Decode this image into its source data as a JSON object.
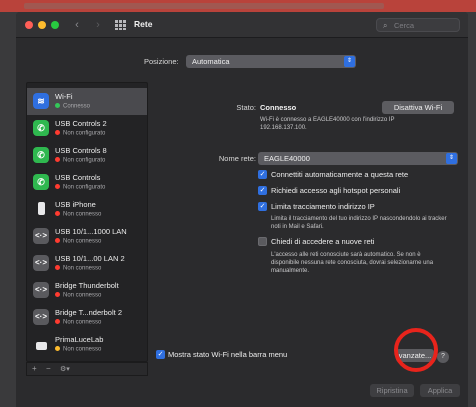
{
  "window": {
    "title": "Rete"
  },
  "search": {
    "placeholder": "Cerca"
  },
  "location": {
    "label": "Posizione:",
    "value": "Automatica"
  },
  "services": [
    {
      "name": "Wi-Fi",
      "status": "Connesso",
      "status_color": "#34c759",
      "icon": "wifi-icon",
      "icon_color": "#2f6fe0"
    },
    {
      "name": "USB Controls 2",
      "status": "Non configurato",
      "status_color": "#ff3b30",
      "icon": "phone-icon",
      "icon_color": "#2fb84f"
    },
    {
      "name": "USB Controls 8",
      "status": "Non configurato",
      "status_color": "#ff3b30",
      "icon": "phone-icon",
      "icon_color": "#2fb84f"
    },
    {
      "name": "USB Controls",
      "status": "Non configurato",
      "status_color": "#ff3b30",
      "icon": "phone-icon",
      "icon_color": "#2fb84f"
    },
    {
      "name": "USB iPhone",
      "status": "Non connesso",
      "status_color": "#ff3b30",
      "icon": "iphone-icon",
      "icon_color": "#4a4a4e"
    },
    {
      "name": "USB 10/1...1000 LAN",
      "status": "Non connesso",
      "status_color": "#ff3b30",
      "icon": "ethernet-icon",
      "icon_color": "#5a5a5e"
    },
    {
      "name": "USB 10/1...00 LAN 2",
      "status": "Non connesso",
      "status_color": "#ff3b30",
      "icon": "ethernet-icon",
      "icon_color": "#5a5a5e"
    },
    {
      "name": "Bridge Thunderbolt",
      "status": "Non connesso",
      "status_color": "#ff3b30",
      "icon": "bridge-icon",
      "icon_color": "#5a5a5e"
    },
    {
      "name": "Bridge T...nderbolt 2",
      "status": "Non connesso",
      "status_color": "#ff3b30",
      "icon": "bridge-icon",
      "icon_color": "#5a5a5e"
    },
    {
      "name": "PrimaLuceLab",
      "status": "Non connesso",
      "status_color": "#febc2e",
      "icon": "lock-icon",
      "icon_color": "#5a5a5e"
    }
  ],
  "sidebar_controls": {
    "add": "+",
    "remove": "−",
    "action": "⚙▾"
  },
  "detail": {
    "status_label": "Stato:",
    "status_value": "Connesso",
    "disable_button": "Disattiva Wi-Fi",
    "status_desc_1": "Wi-Fi è connesso a EAGLE40000 con l'indirizzo IP",
    "status_desc_2": "192.168.137.100.",
    "network_label": "Nome rete:",
    "network_value": "EAGLE40000",
    "opt_auto_join": "Connettiti automaticamente a questa rete",
    "opt_hotspot": "Richiedi accesso agli hotspot personali",
    "opt_limit_tracking": "Limita tracciamento indirizzo IP",
    "limit_desc_1": "Limita il tracciamento del tuo indirizzo IP nascondendolo ai tracker",
    "limit_desc_2": "noti in Mail e Safari.",
    "opt_ask_join": "Chiedi di accedere a nuove reti",
    "ask_desc_1": "L'accesso alle reti conosciute sarà automatico. Se non è",
    "ask_desc_2": "disponibile nessuna rete conosciuta, dovrai selezionarne una",
    "ask_desc_3": "manualmente."
  },
  "footer": {
    "show_menu": "Mostra stato Wi-Fi nella barra menu",
    "advanced_button": "vanzate...",
    "help": "?",
    "revert_button": "Ripristina",
    "apply_button": "Applica"
  }
}
